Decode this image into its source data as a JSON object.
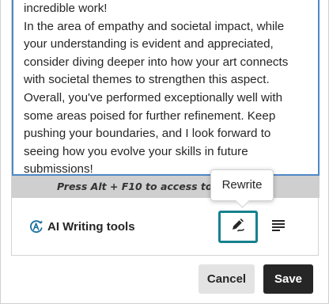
{
  "editor": {
    "lines": [
      "incredible work!",
      "In the area of empathy and societal impact, while",
      "your understanding is evident and appreciated,",
      "consider diving deeper into how your art connects",
      "with societal themes to strengthen this aspect.",
      "Overall, you've performed exceptionally well with",
      "some areas poised for further refinement. Keep",
      "pushing your boundaries, and I look forward to",
      "seeing how you evolve your skills in future",
      "submissions!"
    ]
  },
  "shortcut_hint": "Press Alt + F10 to access toolb",
  "toolbar": {
    "ai_tools_label": "AI Writing tools",
    "ai_icon": "ai-sparkle-icon",
    "rewrite_icon": "pen-icon",
    "align_icon": "align-left-icon"
  },
  "tooltip": {
    "text": "Rewrite"
  },
  "actions": {
    "cancel_label": "Cancel",
    "save_label": "Save"
  },
  "colors": {
    "editor_focus_border": "#4f88c6",
    "rewrite_focus_border": "#17818f",
    "ai_icon_accent": "#1a6f9e",
    "save_bg": "#262626",
    "cancel_bg": "#e3e3e3"
  }
}
